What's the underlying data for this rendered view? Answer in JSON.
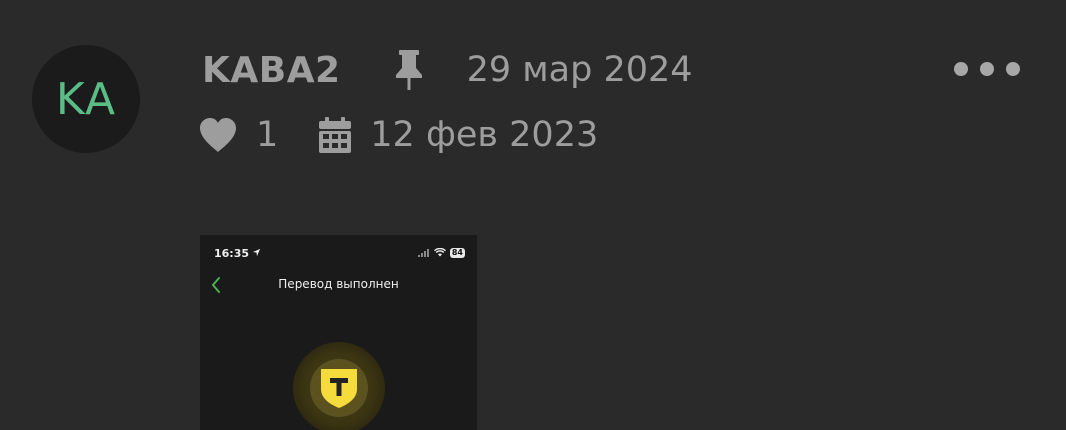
{
  "author": {
    "initials": "KA",
    "username": "KABA2"
  },
  "meta": {
    "pin_icon": "pin-icon",
    "pinned_date": "29 мар 2024",
    "like_icon": "heart-icon",
    "likes": "1",
    "date_icon": "calendar-icon",
    "post_date": "12 фев 2023"
  },
  "menu": {
    "icon": "more-icon"
  },
  "attachment": {
    "status_time": "16:35",
    "battery": "84",
    "title": "Перевод выполнен",
    "logo_letter": "T"
  },
  "colors": {
    "background": "#2a2a2a",
    "avatar_text": "#5bbd86",
    "meta_text": "#9d9d9d",
    "logo_yellow": "#f5dc3c"
  }
}
